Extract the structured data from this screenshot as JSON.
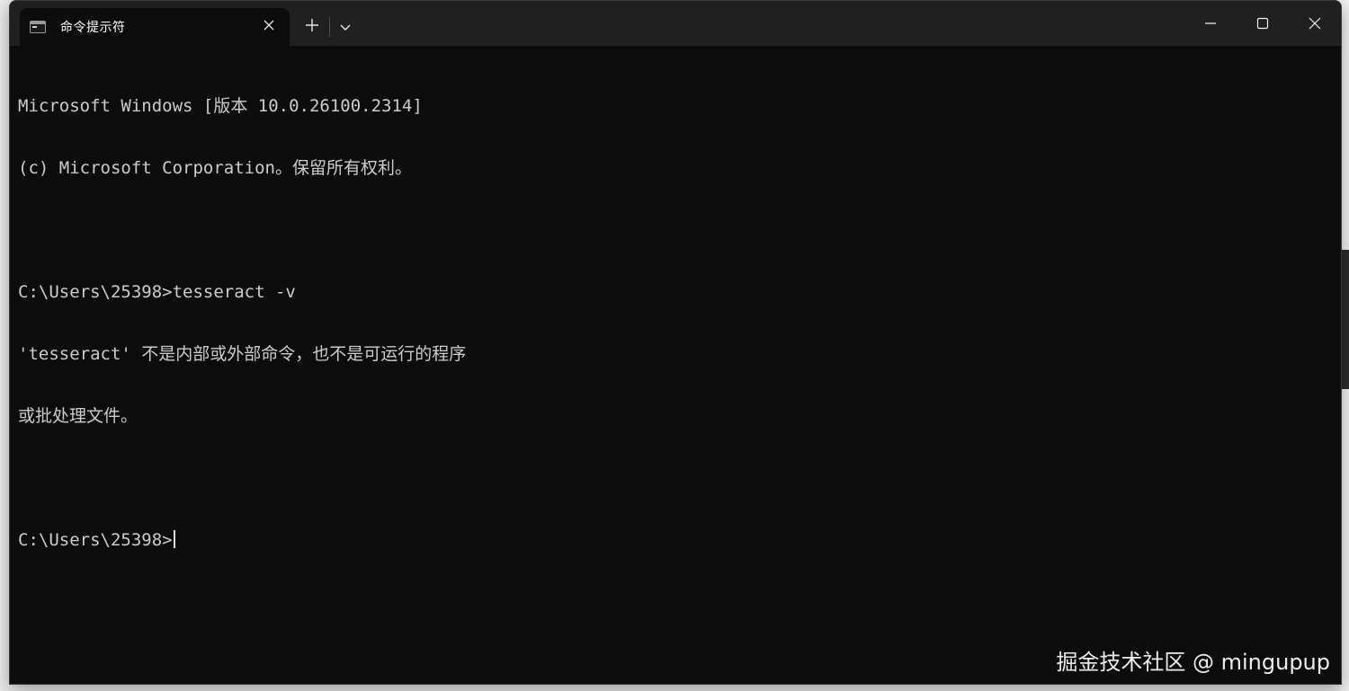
{
  "window": {
    "tab_title": "命令提示符",
    "new_tab_label": "+",
    "icons": {
      "tab_icon": "cmd-icon",
      "tab_close": "close-icon",
      "dropdown": "chevron-down-icon",
      "minimize": "minimize-icon",
      "maximize": "maximize-icon",
      "close": "close-icon"
    }
  },
  "console": {
    "lines": [
      "Microsoft Windows [版本 10.0.26100.2314]",
      "(c) Microsoft Corporation。保留所有权利。",
      "",
      "C:\\Users\\25398>tesseract -v",
      "'tesseract' 不是内部或外部命令，也不是可运行的程序",
      "或批处理文件。",
      "",
      "C:\\Users\\25398>"
    ]
  },
  "watermark": {
    "text": "掘金技术社区 @ mingupup"
  },
  "colors": {
    "console_bg": "#0c0c0c",
    "titlebar_bg": "#202020",
    "text": "#cccccc"
  }
}
